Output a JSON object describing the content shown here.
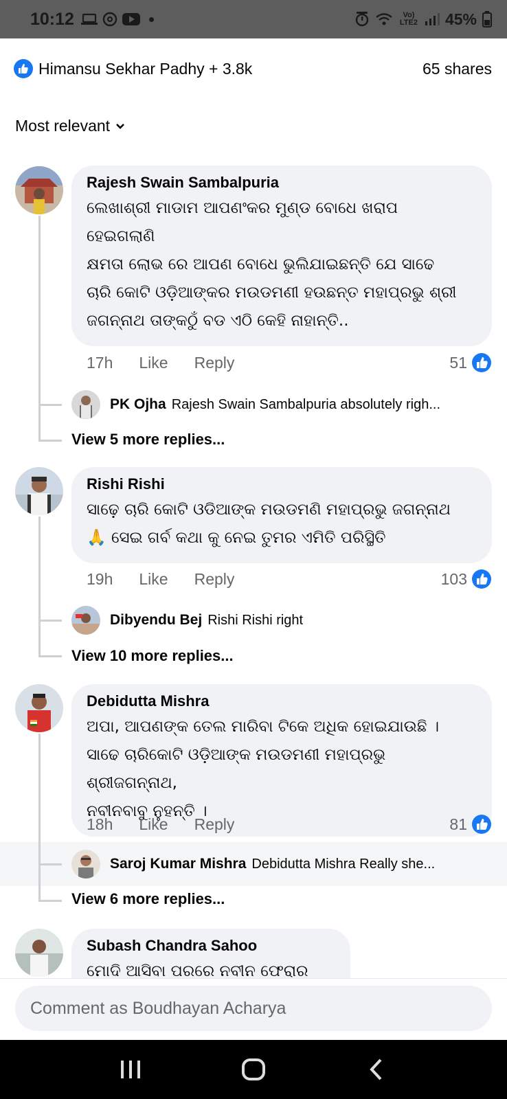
{
  "status_bar": {
    "time": "10:12",
    "battery": "45%",
    "network": "Vo) LTE2"
  },
  "post": {
    "reactors": "Himansu Sekhar Padhy + 3.8k",
    "shares": "65 shares",
    "sort_label": "Most relevant"
  },
  "comments": [
    {
      "author": "Rajesh Swain Sambalpuria",
      "text": "ଲେଖାଶ୍ରୀ ମାଡାମ ଆପଣଂକର ମୁଣ୍ଡ ବୋଧେ ଖରାପ\nହେଇଗଲାଣି\nକ୍ଷମତା ଲୋଭ ରେ ଆପଣ ବୋଧେ ଭୁଲିଯାଇଛନ୍ତି ଯେ ସାଢେ\nଚାରି କୋଟି ଓଡ଼ିଆଙ୍କର ମଉଡମଣୀ ହଉଛନ୍ତ ମହାପ୍ରଭୁ ଶ୍ରୀ\nଜଗନ୍ନାଥ ତାଙ୍କଠୁଁ ବଡ ଏଠି କେହି ନାହାନ୍ତି..",
      "time": "17h",
      "like": "Like",
      "reply": "Reply",
      "likes": "51",
      "reply_preview": {
        "author": "PK Ojha",
        "text": "Rajesh Swain Sambalpuria absolutely righ..."
      },
      "view_more": "View 5 more replies..."
    },
    {
      "author": "Rishi Rishi",
      "text": "ସାଢ଼େ ଚାରି କୋଟି ଓଡିଆଙ୍କ ମଉଡମଣି ମହାପ୍ରଭୁ ଜଗନ୍ନାଥ\n🙏 ସେଇ ଗର୍ବ କଥା କୁ ନେଇ ତୁମର ଏମିତି ପରିସ୍ଥିତି",
      "time": "19h",
      "like": "Like",
      "reply": "Reply",
      "likes": "103",
      "reply_preview": {
        "author": "Dibyendu Bej",
        "text": "Rishi Rishi right"
      },
      "view_more": "View 10 more replies..."
    },
    {
      "author": "Debidutta Mishra",
      "text": "ଅପା, ଆପଣଙ୍କ ତେଲ ମାରିବା ଟିକେ ଅଧିକ ହୋଇଯାଉଛି ।\nସାଢେ ଚାରିକୋଟି ଓଡ଼ିଆଙ୍କ ମଉଡମଣୀ ମହାପ୍ରଭୁ ଶ୍ରୀଜଗନ୍ନାଥ,\nନବୀନବାବୁ ନୁହନ୍ତି ।",
      "time": "18h",
      "like": "Like",
      "reply": "Reply",
      "likes": "81",
      "reply_preview": {
        "author": "Saroj Kumar Mishra",
        "text": "Debidutta Mishra Really she..."
      },
      "view_more": "View 6 more replies..."
    },
    {
      "author": "Subash Chandra Sahoo",
      "text": "ମୋଦି ଆସିବା ପରରେ ନବୀନ ଫେରାର"
    }
  ],
  "composer": {
    "placeholder": "Comment as Boudhayan Acharya"
  },
  "colors": {
    "facebook_blue": "#1877f2",
    "bubble_bg": "#f0f2f5",
    "meta_gray": "#65676b"
  }
}
